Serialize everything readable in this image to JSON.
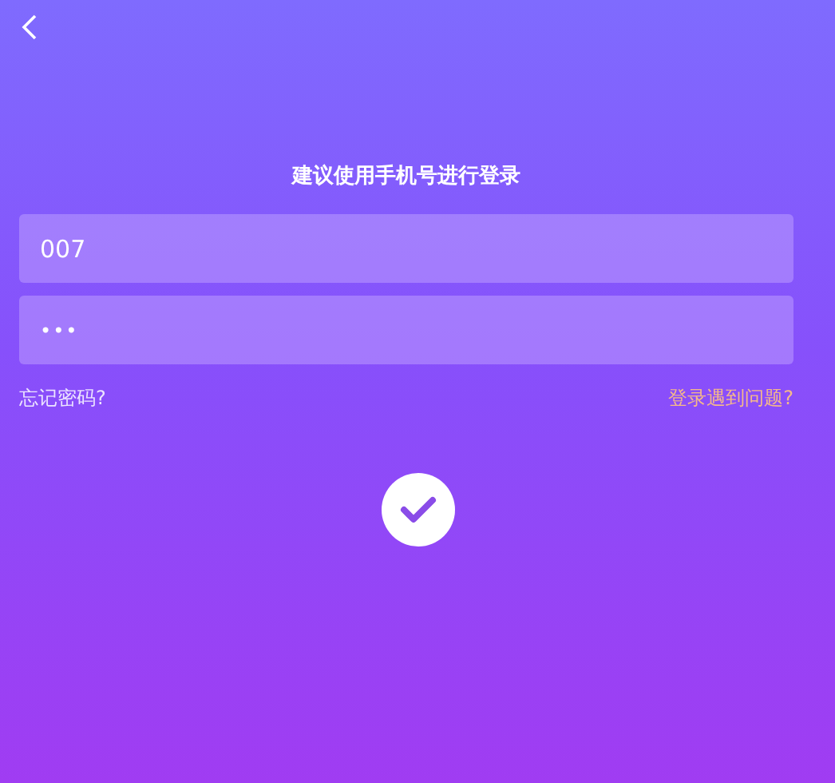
{
  "title": "建议使用手机号进行登录",
  "fields": [
    {
      "kind": "account",
      "value": "007"
    },
    {
      "kind": "password",
      "value": "•••"
    }
  ],
  "links": [
    {
      "label": "忘记密码?",
      "kind": "forgot"
    },
    {
      "label": "登录遇到问题?",
      "kind": "help"
    }
  ]
}
